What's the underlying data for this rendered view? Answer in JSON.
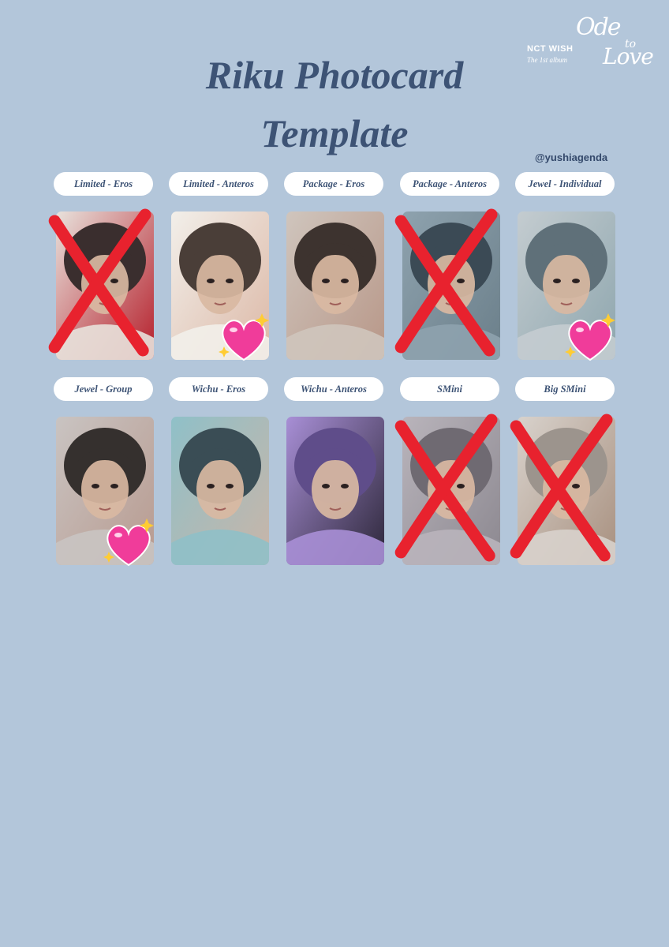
{
  "title_line1": "Riku Photocard",
  "title_line2": "Template",
  "handle": "@yushiagenda",
  "logo": {
    "ode": "Ode",
    "to": "to",
    "love": "Love",
    "brand": "NCT WISH",
    "sub": "The 1st album"
  },
  "cards": [
    {
      "label": "Limited - Eros",
      "status": "crossed",
      "palette": [
        "#3a2e2e",
        "#e8e2dc",
        "#b51f2b"
      ]
    },
    {
      "label": "Limited - Anteros",
      "status": "heart",
      "palette": [
        "#4a3e38",
        "#f2efea",
        "#dcb8a6"
      ]
    },
    {
      "label": "Package - Eros",
      "status": "none",
      "palette": [
        "#3d332f",
        "#cfc5bd",
        "#b89788"
      ]
    },
    {
      "label": "Package - Anteros",
      "status": "crossed",
      "palette": [
        "#3b4a55",
        "#8ea2ae",
        "#6b7f8a"
      ]
    },
    {
      "label": "Jewel - Individual",
      "status": "heart",
      "palette": [
        "#5f7079",
        "#c4ccd0",
        "#8ea6ae"
      ]
    },
    {
      "label": "Jewel - Group",
      "status": "heart",
      "palette": [
        "#35302e",
        "#c9c4c2",
        "#b89a8f"
      ]
    },
    {
      "label": "Wichu - Eros",
      "status": "none",
      "palette": [
        "#3a4d55",
        "#8fc0c8",
        "#c9b5a8"
      ]
    },
    {
      "label": "Wichu - Anteros",
      "status": "none",
      "palette": [
        "#5f4d8a",
        "#a88fd6",
        "#2c2638"
      ]
    },
    {
      "label": "SMini",
      "status": "crossed",
      "palette": [
        "#6f6a72",
        "#b9b4bb",
        "#8c8890"
      ]
    },
    {
      "label": "Big SMini",
      "status": "crossed",
      "palette": [
        "#9c948d",
        "#d8d2cc",
        "#a8907f"
      ]
    }
  ],
  "colors": {
    "background": "#b3c6da",
    "title": "#3d5375",
    "cross": "#e8222e",
    "heart": "#f03c9a"
  }
}
